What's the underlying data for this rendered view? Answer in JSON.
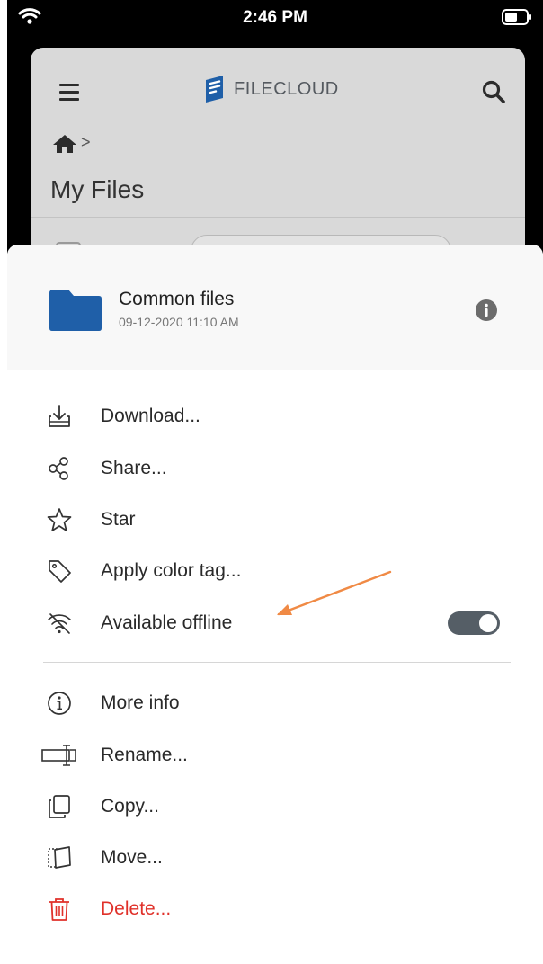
{
  "status_bar": {
    "time": "2:46 PM",
    "icons": [
      "wifi-icon",
      "battery-icon"
    ]
  },
  "app_header": {
    "brand": "FILECLOUD",
    "icons": [
      "hamburger-menu-icon",
      "filecloud-logo-icon",
      "search-icon"
    ]
  },
  "breadcrumb": {
    "icon": "home-icon",
    "separator": ">"
  },
  "page_title": "My Files",
  "sheet": {
    "item": {
      "name": "Common files",
      "date": "09-12-2020 11:10 AM",
      "icons": [
        "folder-icon",
        "info-icon"
      ]
    },
    "menu_group_1": [
      {
        "label": "Download...",
        "icon": "download-icon"
      },
      {
        "label": "Share...",
        "icon": "share-icon"
      },
      {
        "label": "Star",
        "icon": "star-icon"
      },
      {
        "label": "Apply color tag...",
        "icon": "tag-icon"
      },
      {
        "label": "Available offline",
        "icon": "offline-icon"
      }
    ],
    "offline_toggle_on": true,
    "menu_group_2": [
      {
        "label": "More info",
        "icon": "info-circle-icon"
      },
      {
        "label": "Rename...",
        "icon": "rename-icon"
      },
      {
        "label": "Copy...",
        "icon": "copy-icon"
      },
      {
        "label": "Move...",
        "icon": "move-icon"
      },
      {
        "label": "Delete...",
        "icon": "trash-icon"
      }
    ]
  },
  "colors": {
    "brand_blue": "#1f5fa8",
    "danger": "#e0312a",
    "annotation_arrow": "#f08a45",
    "toggle_on": "#555e66"
  }
}
